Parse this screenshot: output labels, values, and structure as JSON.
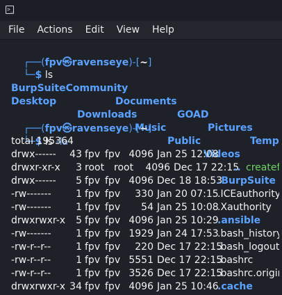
{
  "window": {
    "icon": "terminal-icon",
    "icon_glyph": ">_"
  },
  "menu": {
    "items": [
      "File",
      "Actions",
      "Edit",
      "View",
      "Help"
    ]
  },
  "prompt1": {
    "top": "┌──(",
    "user": "fpv㉿ravenseye",
    "mid": ")-[",
    "dir": "~",
    "end": "]",
    "bottom": "└─",
    "dollar": "$",
    "command": "ls",
    "args": ""
  },
  "ls_output": {
    "row1": [
      "BurpSuiteCommunity",
      "Documents",
      "GOAD",
      "Pictures",
      "Templa"
    ],
    "row2": [
      "Desktop",
      "Downloads",
      "Music",
      "Public",
      "Videos",
      "createfo"
    ]
  },
  "prompt2": {
    "top": "┌──(",
    "user": "fpv㉿ravenseye",
    "mid": ")-[",
    "dir": "~",
    "end": "]",
    "bottom": "└─",
    "dollar": "$",
    "command": "ls",
    "args": " -la"
  },
  "la_output": {
    "total": "total 195364",
    "rows": [
      {
        "perm": "drwx------",
        "links": "43",
        "owner": "fpv",
        "group": "fpv",
        "size": "4096",
        "date": "Jan 25 12:08",
        "name": ".",
        "kind": "dir"
      },
      {
        "perm": "drwxr-xr-x",
        "links": "3",
        "owner": "root",
        "group": "root",
        "size": "4096",
        "date": "Dec 17 22:15",
        "name": "..",
        "kind": "dir"
      },
      {
        "perm": "drwx------",
        "links": "5",
        "owner": "fpv",
        "group": "fpv",
        "size": "4096",
        "date": "Dec 18 18:53",
        "name": ".BurpSuite",
        "kind": "dir"
      },
      {
        "perm": "-rw-------",
        "links": "1",
        "owner": "fpv",
        "group": "fpv",
        "size": "330",
        "date": "Jan 20 07:15",
        "name": ".ICEauthority",
        "kind": "file"
      },
      {
        "perm": "-rw-------",
        "links": "1",
        "owner": "fpv",
        "group": "fpv",
        "size": "54",
        "date": "Jan 25 10:08",
        "name": ".Xauthority",
        "kind": "file"
      },
      {
        "perm": "drwxrwxr-x",
        "links": "5",
        "owner": "fpv",
        "group": "fpv",
        "size": "4096",
        "date": "Jan 25 10:29",
        "name": ".ansible",
        "kind": "dir"
      },
      {
        "perm": "-rw-------",
        "links": "1",
        "owner": "fpv",
        "group": "fpv",
        "size": "1929",
        "date": "Jan 24 17:53",
        "name": ".bash_history",
        "kind": "file"
      },
      {
        "perm": "-rw-r--r--",
        "links": "1",
        "owner": "fpv",
        "group": "fpv",
        "size": "220",
        "date": "Dec 17 22:15",
        "name": ".bash_logout",
        "kind": "file"
      },
      {
        "perm": "-rw-r--r--",
        "links": "1",
        "owner": "fpv",
        "group": "fpv",
        "size": "5551",
        "date": "Dec 17 22:15",
        "name": ".bashrc",
        "kind": "file"
      },
      {
        "perm": "-rw-r--r--",
        "links": "1",
        "owner": "fpv",
        "group": "fpv",
        "size": "3526",
        "date": "Dec 17 22:15",
        "name": ".bashrc.original",
        "kind": "file"
      },
      {
        "perm": "drwxrwxr-x",
        "links": "34",
        "owner": "fpv",
        "group": "fpv",
        "size": "4096",
        "date": "Jan 25 10:46",
        "name": ".cache",
        "kind": "dir"
      }
    ]
  },
  "colors": {
    "background": "#1e2128",
    "directory": "#5aa2ff",
    "executable": "#6fd35f",
    "text": "#f0f0f0"
  }
}
